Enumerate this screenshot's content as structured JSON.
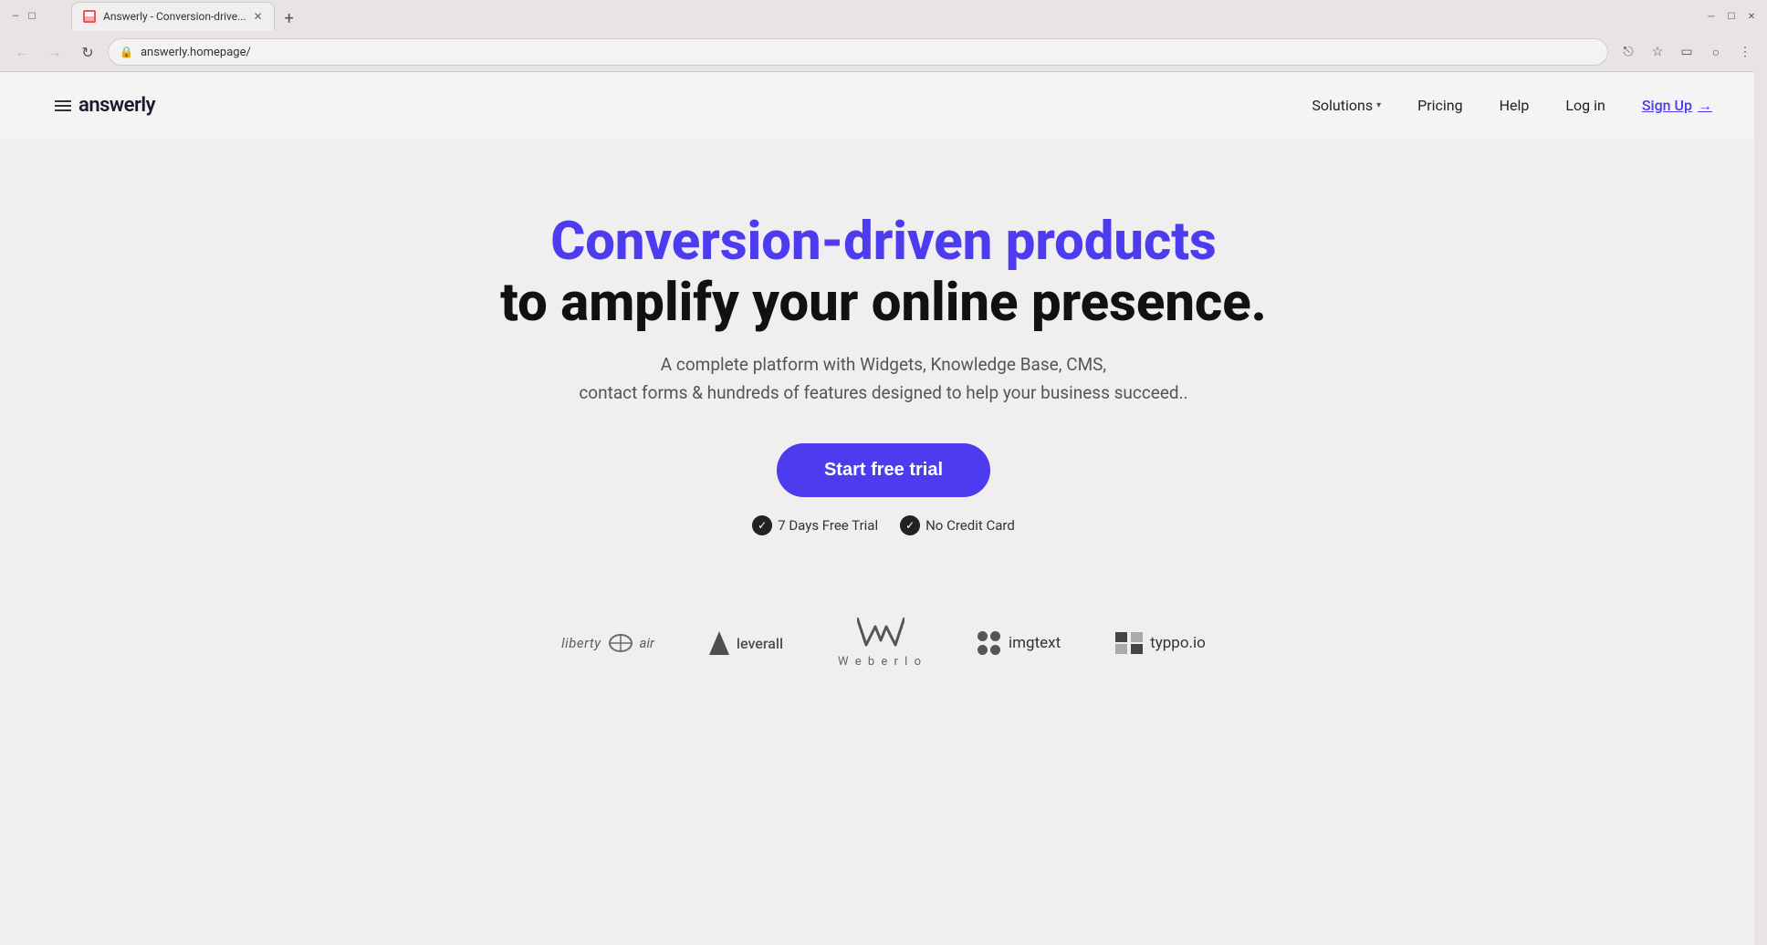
{
  "browser": {
    "tab_title": "Answerly - Conversion-drive...",
    "tab_new_label": "+",
    "url": "answerly.homepage/",
    "back_icon": "←",
    "forward_icon": "→",
    "refresh_icon": "↻",
    "lock_icon": "🔒",
    "share_icon": "⎋",
    "bookmark_icon": "☆",
    "sidebar_icon": "▭",
    "profile_icon": "○",
    "menu_icon": "⋮",
    "dropdown_icon": "⌄"
  },
  "nav": {
    "hamburger_label": "menu",
    "brand": "answerly",
    "solutions_label": "Solutions",
    "pricing_label": "Pricing",
    "help_label": "Help",
    "login_label": "Log in",
    "signup_label": "Sign Up",
    "signup_arrow": "→"
  },
  "hero": {
    "title_colored": "Conversion-driven products",
    "title_black": "to amplify your online presence.",
    "subtitle_line1": "A complete platform with Widgets, Knowledge Base, CMS,",
    "subtitle_line2": "contact forms & hundreds of features designed to help your business succeed..",
    "cta_label": "Start free trial",
    "badge1": "7 Days Free Trial",
    "badge2": "No Credit Card",
    "check_icon": "✓"
  },
  "logos": [
    {
      "name": "liberty-air",
      "label": "liberty air",
      "type": "liberty"
    },
    {
      "name": "leverall",
      "label": "leverall",
      "type": "leverall"
    },
    {
      "name": "weberlo",
      "label": "Weberlo",
      "type": "weberlo"
    },
    {
      "name": "imgtext",
      "label": "imgtext",
      "type": "imgtext"
    },
    {
      "name": "typpo",
      "label": "typpo.io",
      "type": "typpo"
    }
  ],
  "colors": {
    "accent": "#4c3bef",
    "dark": "#111111",
    "muted": "#555555"
  }
}
